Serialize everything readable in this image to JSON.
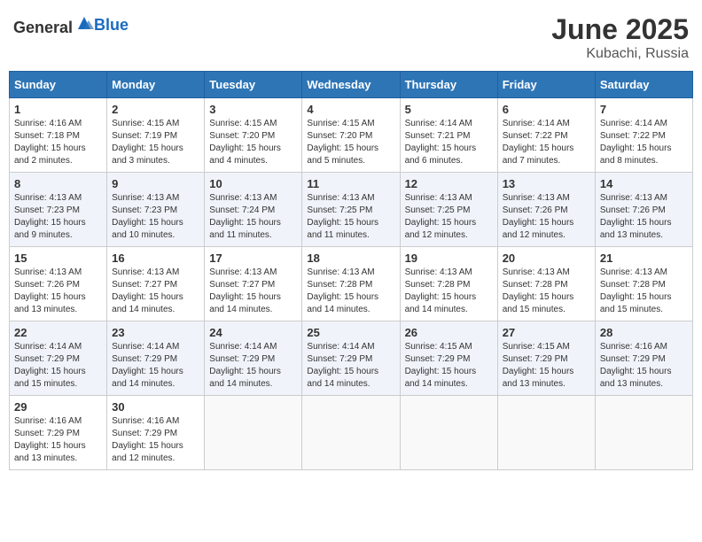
{
  "header": {
    "logo": {
      "general": "General",
      "blue": "Blue"
    },
    "title": "June 2025",
    "location": "Kubachi, Russia"
  },
  "days_of_week": [
    "Sunday",
    "Monday",
    "Tuesday",
    "Wednesday",
    "Thursday",
    "Friday",
    "Saturday"
  ],
  "weeks": [
    [
      {
        "day": "1",
        "sunrise": "4:16 AM",
        "sunset": "7:18 PM",
        "daylight": "15 hours and 2 minutes."
      },
      {
        "day": "2",
        "sunrise": "4:15 AM",
        "sunset": "7:19 PM",
        "daylight": "15 hours and 3 minutes."
      },
      {
        "day": "3",
        "sunrise": "4:15 AM",
        "sunset": "7:20 PM",
        "daylight": "15 hours and 4 minutes."
      },
      {
        "day": "4",
        "sunrise": "4:15 AM",
        "sunset": "7:20 PM",
        "daylight": "15 hours and 5 minutes."
      },
      {
        "day": "5",
        "sunrise": "4:14 AM",
        "sunset": "7:21 PM",
        "daylight": "15 hours and 6 minutes."
      },
      {
        "day": "6",
        "sunrise": "4:14 AM",
        "sunset": "7:22 PM",
        "daylight": "15 hours and 7 minutes."
      },
      {
        "day": "7",
        "sunrise": "4:14 AM",
        "sunset": "7:22 PM",
        "daylight": "15 hours and 8 minutes."
      }
    ],
    [
      {
        "day": "8",
        "sunrise": "4:13 AM",
        "sunset": "7:23 PM",
        "daylight": "15 hours and 9 minutes."
      },
      {
        "day": "9",
        "sunrise": "4:13 AM",
        "sunset": "7:23 PM",
        "daylight": "15 hours and 10 minutes."
      },
      {
        "day": "10",
        "sunrise": "4:13 AM",
        "sunset": "7:24 PM",
        "daylight": "15 hours and 11 minutes."
      },
      {
        "day": "11",
        "sunrise": "4:13 AM",
        "sunset": "7:25 PM",
        "daylight": "15 hours and 11 minutes."
      },
      {
        "day": "12",
        "sunrise": "4:13 AM",
        "sunset": "7:25 PM",
        "daylight": "15 hours and 12 minutes."
      },
      {
        "day": "13",
        "sunrise": "4:13 AM",
        "sunset": "7:26 PM",
        "daylight": "15 hours and 12 minutes."
      },
      {
        "day": "14",
        "sunrise": "4:13 AM",
        "sunset": "7:26 PM",
        "daylight": "15 hours and 13 minutes."
      }
    ],
    [
      {
        "day": "15",
        "sunrise": "4:13 AM",
        "sunset": "7:26 PM",
        "daylight": "15 hours and 13 minutes."
      },
      {
        "day": "16",
        "sunrise": "4:13 AM",
        "sunset": "7:27 PM",
        "daylight": "15 hours and 14 minutes."
      },
      {
        "day": "17",
        "sunrise": "4:13 AM",
        "sunset": "7:27 PM",
        "daylight": "15 hours and 14 minutes."
      },
      {
        "day": "18",
        "sunrise": "4:13 AM",
        "sunset": "7:28 PM",
        "daylight": "15 hours and 14 minutes."
      },
      {
        "day": "19",
        "sunrise": "4:13 AM",
        "sunset": "7:28 PM",
        "daylight": "15 hours and 14 minutes."
      },
      {
        "day": "20",
        "sunrise": "4:13 AM",
        "sunset": "7:28 PM",
        "daylight": "15 hours and 15 minutes."
      },
      {
        "day": "21",
        "sunrise": "4:13 AM",
        "sunset": "7:28 PM",
        "daylight": "15 hours and 15 minutes."
      }
    ],
    [
      {
        "day": "22",
        "sunrise": "4:14 AM",
        "sunset": "7:29 PM",
        "daylight": "15 hours and 15 minutes."
      },
      {
        "day": "23",
        "sunrise": "4:14 AM",
        "sunset": "7:29 PM",
        "daylight": "15 hours and 14 minutes."
      },
      {
        "day": "24",
        "sunrise": "4:14 AM",
        "sunset": "7:29 PM",
        "daylight": "15 hours and 14 minutes."
      },
      {
        "day": "25",
        "sunrise": "4:14 AM",
        "sunset": "7:29 PM",
        "daylight": "15 hours and 14 minutes."
      },
      {
        "day": "26",
        "sunrise": "4:15 AM",
        "sunset": "7:29 PM",
        "daylight": "15 hours and 14 minutes."
      },
      {
        "day": "27",
        "sunrise": "4:15 AM",
        "sunset": "7:29 PM",
        "daylight": "15 hours and 13 minutes."
      },
      {
        "day": "28",
        "sunrise": "4:16 AM",
        "sunset": "7:29 PM",
        "daylight": "15 hours and 13 minutes."
      }
    ],
    [
      {
        "day": "29",
        "sunrise": "4:16 AM",
        "sunset": "7:29 PM",
        "daylight": "15 hours and 13 minutes."
      },
      {
        "day": "30",
        "sunrise": "4:16 AM",
        "sunset": "7:29 PM",
        "daylight": "15 hours and 12 minutes."
      },
      null,
      null,
      null,
      null,
      null
    ]
  ],
  "labels": {
    "sunrise": "Sunrise:",
    "sunset": "Sunset:",
    "daylight": "Daylight:"
  }
}
